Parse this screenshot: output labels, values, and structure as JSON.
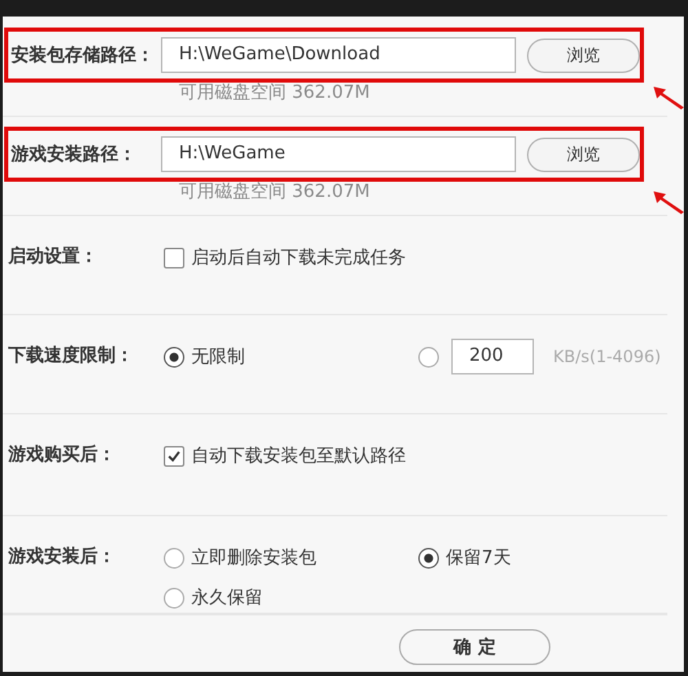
{
  "path_rows": [
    {
      "label": "安装包存储路径：",
      "value": "H:\\WeGame\\Download",
      "button": "浏览",
      "free_space": "可用磁盘空间 362.07M",
      "highlighted": true
    },
    {
      "label": "游戏安装路径：",
      "value": "H:\\WeGame",
      "button": "浏览",
      "free_space": "可用磁盘空间 362.07M",
      "highlighted": true
    }
  ],
  "settings": [
    {
      "label": "启动设置：",
      "options": [
        {
          "kind": "checkbox",
          "label": "启动后自动下载未完成任务",
          "checked": false
        }
      ]
    },
    {
      "label": "下载速度限制：",
      "options": [
        {
          "kind": "radio",
          "label": "无限制",
          "selected": true
        },
        {
          "kind": "radio_input",
          "selected": false,
          "value": "200",
          "unit": "KB/s(1-4096)"
        }
      ]
    },
    {
      "label": "游戏购买后：",
      "options": [
        {
          "kind": "checkbox",
          "label": "自动下载安装包至默认路径",
          "checked": true
        }
      ]
    },
    {
      "label": "游戏安装后：",
      "options": [
        {
          "kind": "radio",
          "label": "立即删除安装包",
          "selected": false
        },
        {
          "kind": "radio",
          "label": "保留7天",
          "selected": true
        },
        {
          "kind": "radio",
          "label": "永久保留",
          "selected": false
        }
      ]
    }
  ],
  "footer": {
    "ok_button": "确 定"
  }
}
